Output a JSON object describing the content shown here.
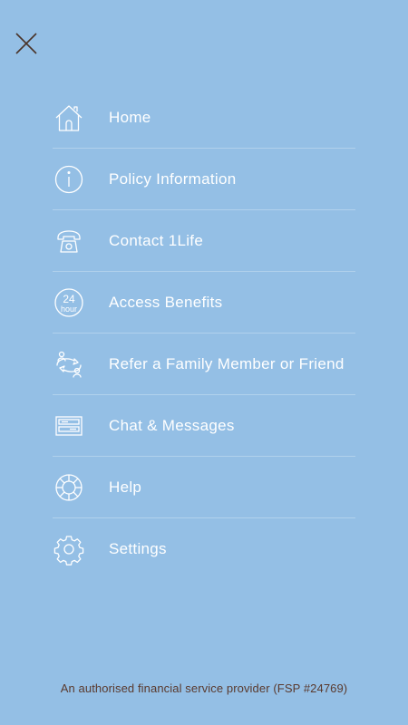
{
  "close": {
    "icon": "close-icon"
  },
  "menu": {
    "items": [
      {
        "label": "Home",
        "icon": "home-icon"
      },
      {
        "label": "Policy Information",
        "icon": "info-icon"
      },
      {
        "label": "Contact 1Life",
        "icon": "telephone-icon"
      },
      {
        "label": "Access Benefits",
        "icon": "24-hour-icon",
        "icon_text_top": "24",
        "icon_text_bottom": "hour"
      },
      {
        "label": "Refer a Family Member or Friend",
        "icon": "refer-icon"
      },
      {
        "label": "Chat & Messages",
        "icon": "chat-icon"
      },
      {
        "label": "Help",
        "icon": "lifebuoy-icon"
      },
      {
        "label": "Settings",
        "icon": "gear-icon"
      }
    ]
  },
  "footer": {
    "text": "An authorised financial service provider (FSP #24769)"
  },
  "colors": {
    "background": "#94bfe5",
    "text": "#ffffff",
    "footer_text": "#5a3a2e",
    "close_icon": "#4a3328"
  }
}
